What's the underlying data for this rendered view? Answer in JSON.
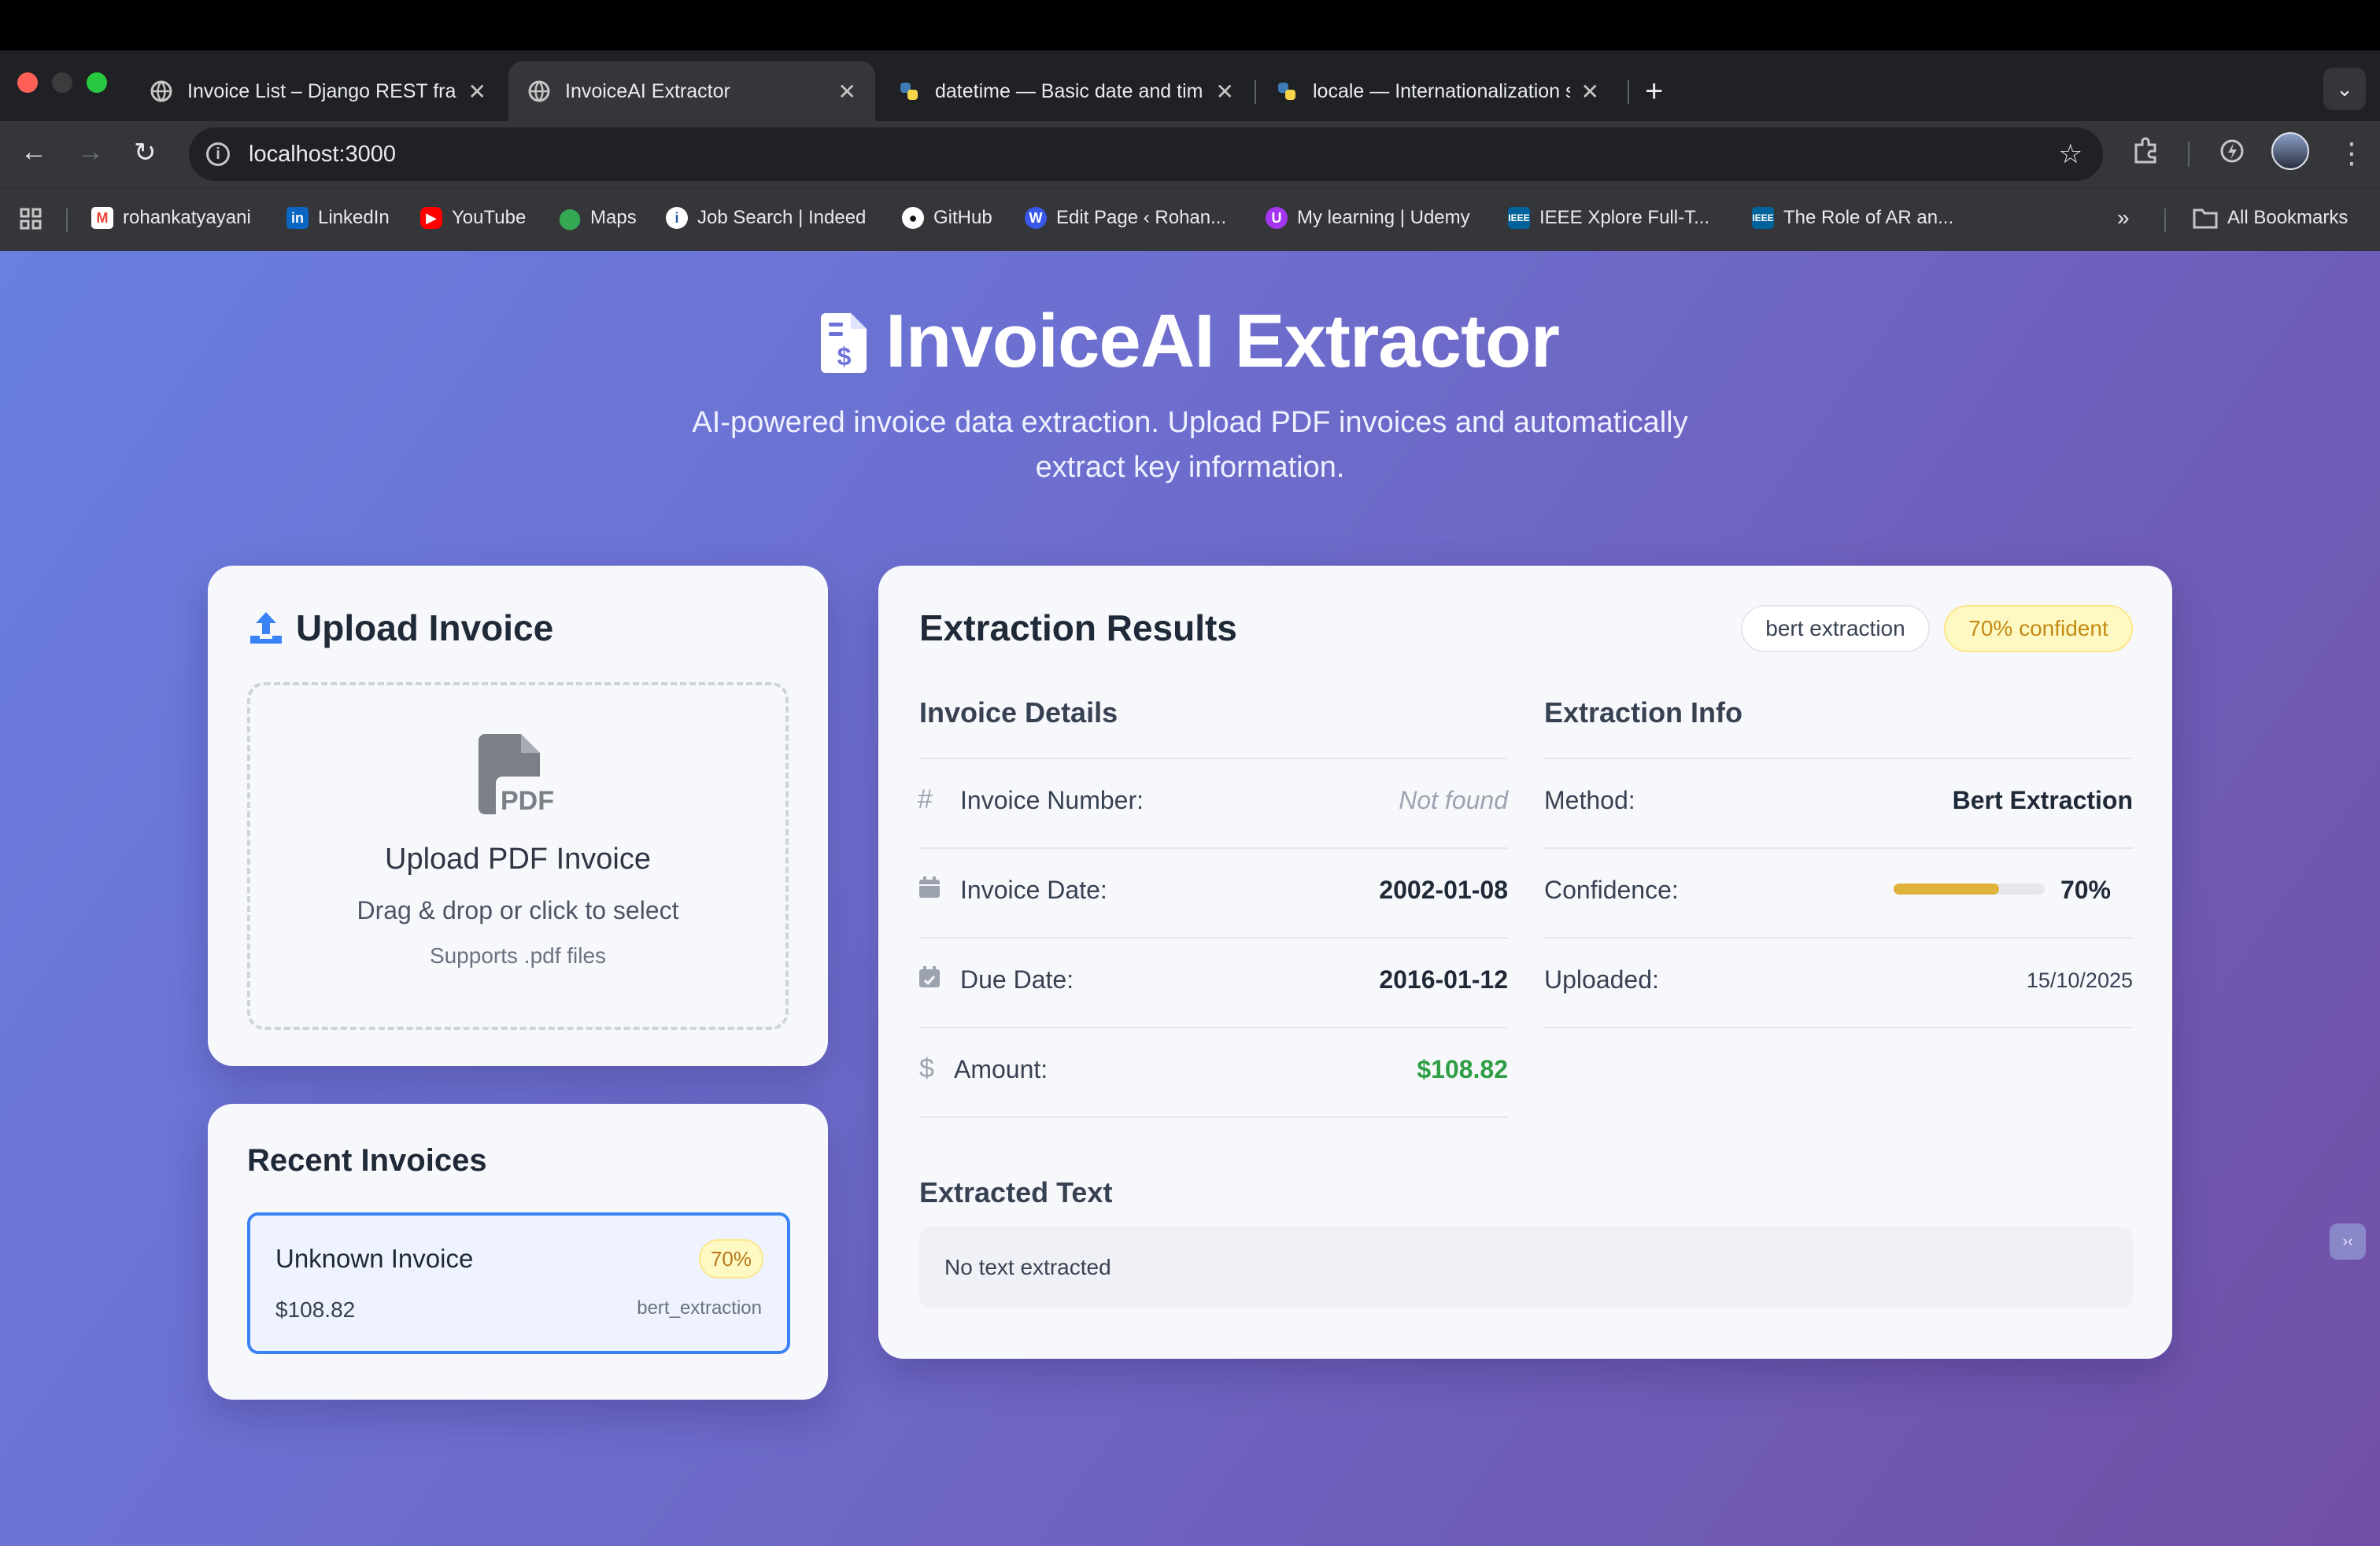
{
  "browser": {
    "tabs": [
      {
        "title": "Invoice List – Django REST fra",
        "active": false
      },
      {
        "title": "InvoiceAI Extractor",
        "active": true
      },
      {
        "title": "datetime — Basic date and tim",
        "active": false
      },
      {
        "title": "locale — Internationalization s",
        "active": false
      }
    ],
    "url": "localhost:3000",
    "bookmarks": [
      {
        "label": "rohankatyayani",
        "icon": "gmail-icon"
      },
      {
        "label": "LinkedIn",
        "icon": "linkedin-icon"
      },
      {
        "label": "YouTube",
        "icon": "youtube-icon"
      },
      {
        "label": "Maps",
        "icon": "maps-icon"
      },
      {
        "label": "Job Search | Indeed",
        "icon": "indeed-icon"
      },
      {
        "label": "GitHub",
        "icon": "github-icon"
      },
      {
        "label": "Edit Page ‹ Rohan...",
        "icon": "wordpress-icon"
      },
      {
        "label": "My learning | Udemy",
        "icon": "udemy-icon"
      },
      {
        "label": "IEEE Xplore Full-T...",
        "icon": "ieee-icon"
      },
      {
        "label": "The Role of AR an...",
        "icon": "ieee-icon"
      }
    ],
    "all_bookmarks": "All Bookmarks"
  },
  "hero": {
    "title": "InvoiceAI Extractor",
    "subtitle": "AI-powered invoice data extraction. Upload PDF invoices and automatically extract key information."
  },
  "upload": {
    "title": "Upload Invoice",
    "drop_title": "Upload PDF Invoice",
    "drop_hint": "Drag & drop or click to select",
    "drop_support": "Supports .pdf files",
    "pdf_label": "PDF"
  },
  "recent": {
    "title": "Recent Invoices",
    "items": [
      {
        "name": "Unknown Invoice",
        "confidence": "70%",
        "amount": "$108.82",
        "method": "bert_extraction"
      }
    ]
  },
  "results": {
    "title": "Extraction Results",
    "method_badge": "bert extraction",
    "confidence_badge": "70% confident",
    "invoice_details": {
      "title": "Invoice Details",
      "number_label": "Invoice Number:",
      "number_value": "Not found",
      "date_label": "Invoice Date:",
      "date_value": "2002-01-08",
      "due_label": "Due Date:",
      "due_value": "2016-01-12",
      "amount_label": "Amount:",
      "amount_value": "$108.82"
    },
    "extraction_info": {
      "title": "Extraction Info",
      "method_label": "Method:",
      "method_value": "Bert Extraction",
      "confidence_label": "Confidence:",
      "confidence_value": "70%",
      "confidence_fraction": 0.7,
      "uploaded_label": "Uploaded:",
      "uploaded_value": "15/10/2025"
    },
    "extracted_text": {
      "title": "Extracted Text",
      "content": "No text extracted"
    }
  },
  "colors": {
    "accent_blue": "#3b82f6",
    "confidence_yellow": "#eab308",
    "amount_green": "#2f9e44"
  }
}
